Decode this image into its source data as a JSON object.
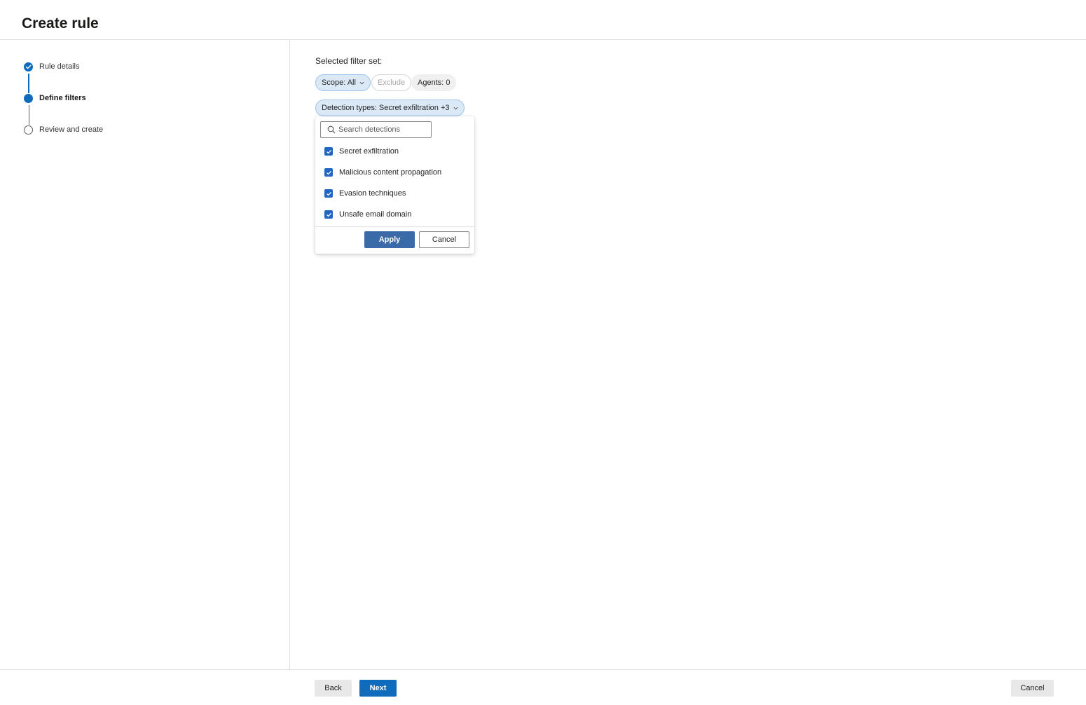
{
  "header": {
    "title": "Create rule"
  },
  "stepper": {
    "steps": [
      {
        "label": "Rule details",
        "state": "completed"
      },
      {
        "label": "Define filters",
        "state": "current"
      },
      {
        "label": "Review and create",
        "state": "pending"
      }
    ]
  },
  "filters": {
    "title": "Selected filter set:",
    "chips": {
      "scope": "Scope: All",
      "exclude": "Exclude",
      "agents": "Agents: 0",
      "detection_types": "Detection types: Secret exfiltration +3"
    }
  },
  "dropdown": {
    "search_placeholder": "Search detections",
    "options": [
      {
        "label": "Secret exfiltration",
        "checked": true
      },
      {
        "label": "Malicious content propagation",
        "checked": true
      },
      {
        "label": "Evasion techniques",
        "checked": true
      },
      {
        "label": "Unsafe email domain",
        "checked": true
      }
    ],
    "apply_label": "Apply",
    "cancel_label": "Cancel"
  },
  "footer": {
    "back_label": "Back",
    "next_label": "Next",
    "cancel_label": "Cancel"
  },
  "colors": {
    "accent": "#0f6cbd",
    "apply_button": "#3b6aa8",
    "checkbox": "#2266c3",
    "chip_selected_bg": "#dbe9f7"
  }
}
